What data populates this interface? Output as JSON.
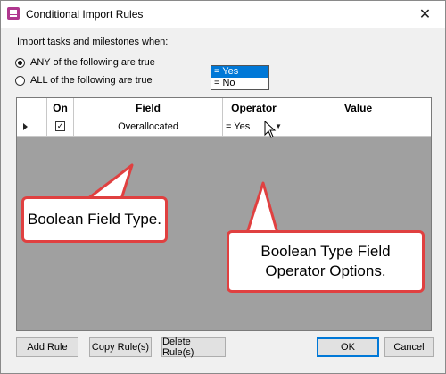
{
  "window": {
    "title": "Conditional Import Rules",
    "close_glyph": "✕"
  },
  "intro_text": "Import tasks and milestones when:",
  "match_options": [
    {
      "label": "ANY of the following are true",
      "selected": true
    },
    {
      "label": "ALL of the following are true",
      "selected": false
    }
  ],
  "grid": {
    "columns": [
      "On",
      "Field",
      "Operator",
      "Value"
    ],
    "rows": [
      {
        "on": true,
        "checkmark": "✓",
        "field": "Overallocated",
        "operator": "= Yes",
        "value": ""
      }
    ],
    "operator_dropdown": {
      "options": [
        "= Yes",
        "= No"
      ],
      "highlighted": "= Yes"
    }
  },
  "annotations": {
    "left": "Boolean Field Type.",
    "right_line1": "Boolean Type Field",
    "right_line2": "Operator Options."
  },
  "buttons": {
    "add_rule": "Add Rule",
    "copy_rules": "Copy Rule(s)",
    "delete_rules": "Delete Rule(s)",
    "ok": "OK",
    "cancel": "Cancel"
  },
  "colors": {
    "app_icon": "#b0388f",
    "callout_border": "#e04040",
    "selection": "#0078d7",
    "grid_background": "#a0a0a0"
  }
}
